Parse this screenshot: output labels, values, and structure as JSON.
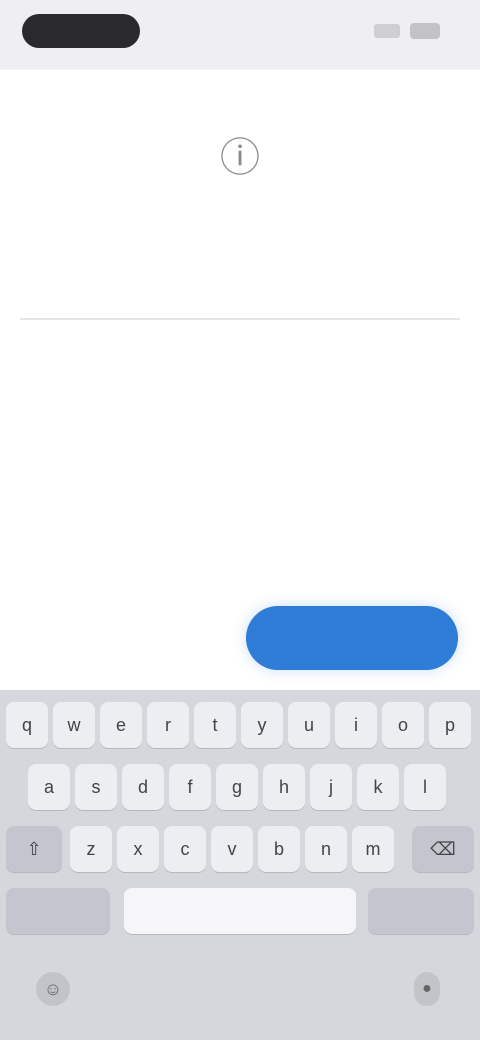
{
  "status_bar": {
    "time": "",
    "signal": "signal-icon",
    "battery": "battery-icon"
  },
  "dialog": {
    "icon": "info-icon",
    "title": "",
    "input_placeholder": "",
    "input_value": ""
  },
  "buttons": {
    "cancel_label": "",
    "ok_label": ""
  },
  "keyboard": {
    "row1": [
      "q",
      "w",
      "e",
      "r",
      "t",
      "y",
      "u",
      "i",
      "o",
      "p"
    ],
    "row2": [
      "a",
      "s",
      "d",
      "f",
      "g",
      "h",
      "j",
      "k",
      "l"
    ],
    "row3": [
      "z",
      "x",
      "c",
      "v",
      "b",
      "n",
      "m"
    ],
    "shift_icon": "shift-icon",
    "backspace_icon": "backspace-icon",
    "numbers_label": "",
    "space_label": "",
    "return_label": "",
    "emoji_icon": "emoji-icon",
    "mic_icon": "microphone-icon"
  },
  "colors": {
    "accent": "#2e7cd6",
    "keyboard_bg": "#d6d7dd",
    "status_bg": "#efeff1"
  }
}
